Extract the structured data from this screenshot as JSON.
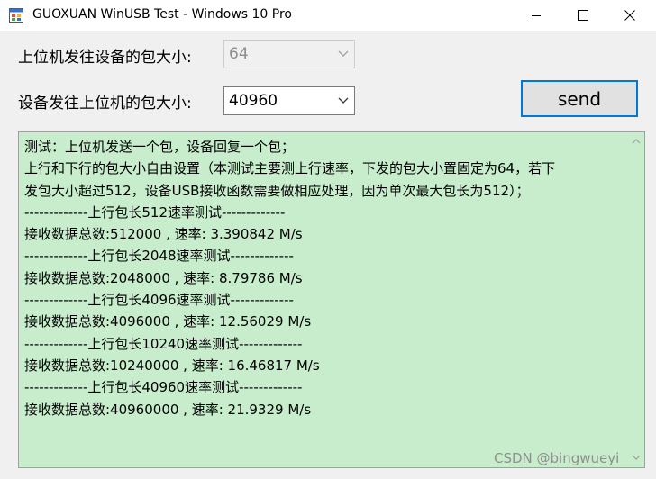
{
  "window": {
    "title": "GUOXUAN WinUSB Test - Windows 10 Pro",
    "icon": "app-window-icon"
  },
  "controls": {
    "host_to_device_label": "上位机发往设备的包大小:",
    "host_to_device_value": "64",
    "host_to_device_disabled": true,
    "device_to_host_label": "设备发往上位机的包大小:",
    "device_to_host_value": "40960",
    "send_label": "send"
  },
  "log": {
    "lines": [
      "测试：上位机发送一个包，设备回复一个包；",
      "上行和下行的包大小自由设置（本测试主要测上行速率，下发的包大小置固定为64，若下",
      "发包大小超过512，设备USB接收函数需要做相应处理，因为单次最大包长为512）；",
      "-------------上行包长512速率测试-------------",
      "接收数据总数:512000 , 速率: 3.390842 M/s",
      "-------------上行包长2048速率测试-------------",
      "接收数据总数:2048000 , 速率: 8.79786 M/s",
      "-------------上行包长4096速率测试-------------",
      "接收数据总数:4096000 , 速率: 12.56029 M/s",
      "-------------上行包长10240速率测试-------------",
      "接收数据总数:10240000 , 速率: 16.46817 M/s",
      "-------------上行包长40960速率测试-------------",
      "接收数据总数:40960000 , 速率: 21.9329 M/s"
    ],
    "background": "#c7edcc"
  },
  "watermark": "CSDN @bingwueyi",
  "colors": {
    "accent": "#0078d7",
    "window_bg": "#f0f0f0"
  }
}
